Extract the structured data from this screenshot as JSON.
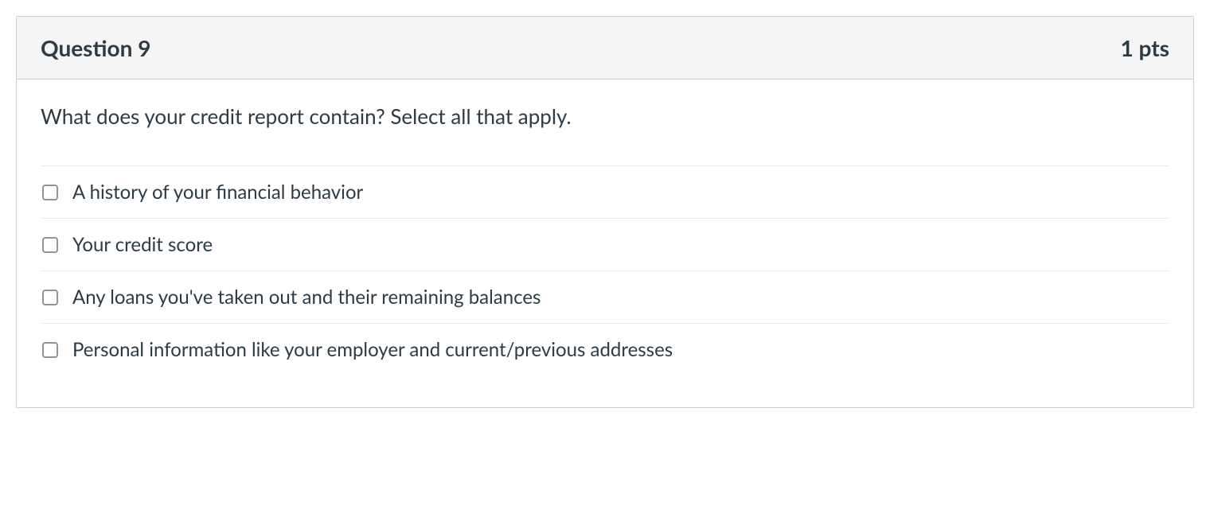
{
  "question": {
    "title": "Question 9",
    "points": "1 pts",
    "prompt": "What does your credit report contain? Select all that apply.",
    "options": [
      {
        "label": "A history of your financial behavior"
      },
      {
        "label": "Your credit score"
      },
      {
        "label": "Any loans you've taken out and their remaining balances"
      },
      {
        "label": "Personal information like your employer and current/previous addresses"
      }
    ]
  }
}
